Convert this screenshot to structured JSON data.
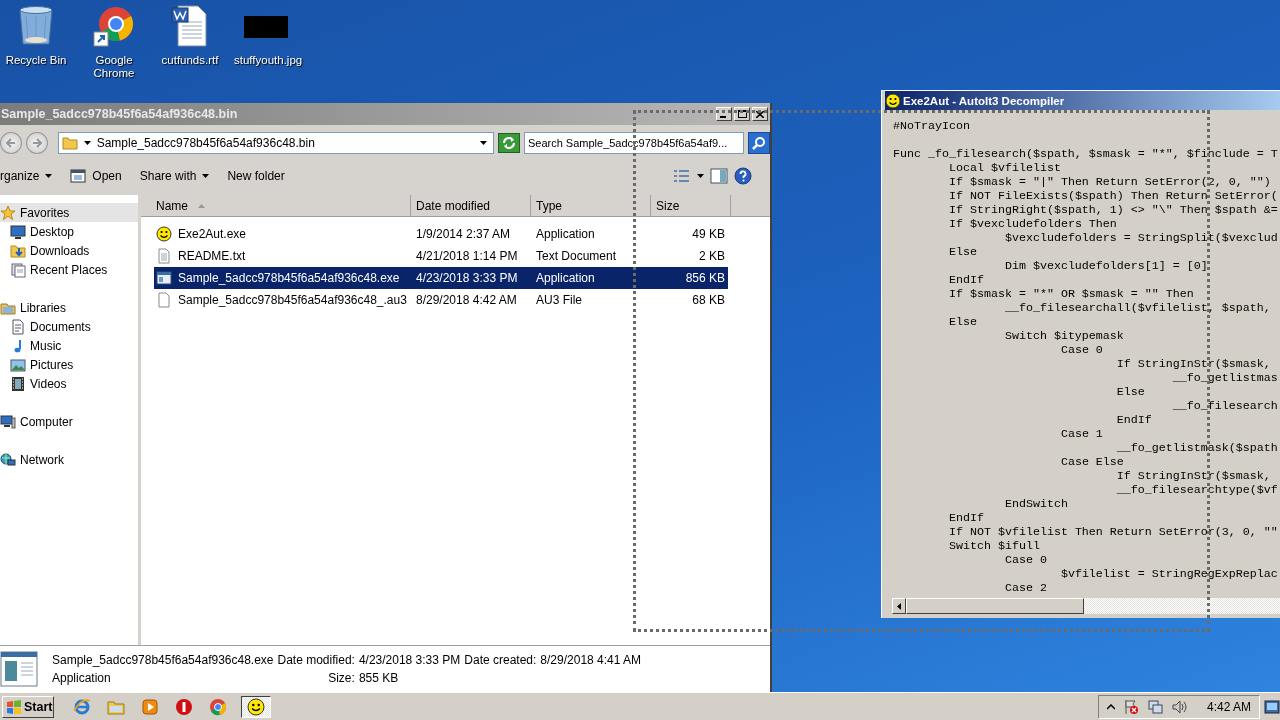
{
  "desktop_icons": [
    {
      "label": "Recycle Bin",
      "kind": "recycle"
    },
    {
      "label": "Google Chrome",
      "kind": "browser"
    },
    {
      "label": "cutfunds.rtf",
      "kind": "document"
    },
    {
      "label": "stuffyouth.jpg",
      "kind": "image"
    }
  ],
  "explorer": {
    "title": "Sample_5adcc978b45f6a54af936c48.bin",
    "address": "Sample_5adcc978b45f6a54af936c48.bin",
    "search": {
      "placeholder": "Search Sample_5adcc978b45f6a54af9..."
    },
    "toolbar": [
      {
        "label": "rganize",
        "kind": "menu"
      },
      {
        "label": "Open",
        "kind": "icon-button"
      },
      {
        "label": "Share with",
        "kind": "menu"
      },
      {
        "label": "New folder",
        "kind": "button"
      }
    ],
    "sidebar": [
      {
        "label": "Favorites",
        "kind": "star",
        "selected": true,
        "children": [
          {
            "label": "Desktop",
            "kind": "monitor",
            "selected": false
          },
          {
            "label": "Downloads",
            "kind": "downloads",
            "selected": false
          },
          {
            "label": "Recent Places",
            "kind": "recent",
            "selected": false
          }
        ]
      },
      {
        "label": "Libraries",
        "kind": "library",
        "selected": false,
        "children": [
          {
            "label": "Documents",
            "kind": "documents",
            "selected": false
          },
          {
            "label": "Music",
            "kind": "music",
            "selected": false
          },
          {
            "label": "Pictures",
            "kind": "pictures",
            "selected": false
          },
          {
            "label": "Videos",
            "kind": "videos",
            "selected": false
          }
        ]
      },
      {
        "label": "Computer",
        "kind": "computer",
        "selected": false
      },
      {
        "label": "Network",
        "kind": "network",
        "selected": false
      }
    ],
    "columns": [
      {
        "label": "Name",
        "sorted": true
      },
      {
        "label": "Date modified",
        "sorted": false
      },
      {
        "label": "Type",
        "sorted": false
      },
      {
        "label": "Size",
        "sorted": false
      }
    ],
    "files": [
      {
        "name": "Exe2Aut.exe",
        "date": "1/9/2014 2:37 AM",
        "type": "Application",
        "size": "49 KB",
        "kind": "smiley",
        "selected": false
      },
      {
        "name": "README.txt",
        "date": "4/21/2018 1:14 PM",
        "type": "Text Document",
        "size": "2 KB",
        "kind": "text",
        "selected": false
      },
      {
        "name": "Sample_5adcc978b45f6a54af936c48.exe",
        "date": "4/23/2018 3:33 PM",
        "type": "Application",
        "size": "856 KB",
        "kind": "app",
        "selected": true
      },
      {
        "name": "Sample_5adcc978b45f6a54af936c48_.au3",
        "date": "8/29/2018 4:42 AM",
        "type": "AU3 File",
        "size": "68 KB",
        "kind": "blank",
        "selected": false
      }
    ],
    "details": {
      "name": "Sample_5adcc978b45f6a54af936c48.exe",
      "type": "Application",
      "fields": [
        {
          "label": "Date modified:",
          "value": "4/23/2018 3:33 PM"
        },
        {
          "label": "Date created:",
          "value": "8/29/2018 4:41 AM"
        },
        {
          "label": "Size:",
          "value": "855 KB"
        }
      ]
    }
  },
  "decompiler": {
    "title": "Exe2Aut - AutoIt3 Decompiler",
    "blocks": [
      [
        "#NoTrayIcon"
      ],
      [
        "Func _fo_filesearch($spath, $smask = \"*\", $finclude = T",
        "\tLocal $vfilelist",
        "\tIf $smask = \"|\" Then Return SetError(2, 0, \"\")",
        "\tIf NOT FileExists($spath) Then Return SetError(",
        "\tIf StringRight($spath, 1) <> \"\\\" Then $spath &=",
        "\tIf $vexcludefolders Then",
        "\t\t$vexcludefolders = StringSplit($vexclud",
        "\tElse",
        "\t\tDim $vexcludefolders[1] = [0]",
        "\tEndIf",
        "\tIf $smask = \"*\" OR $smask = \"\" Then",
        "\t\t__fo_filesearchall($vfilelist, $spath,",
        "\tElse",
        "\t\tSwitch $itypemask",
        "\t\t\tCase 0",
        "\t\t\t\tIf StringInStr($smask,",
        "\t\t\t\t\t__fo_getlistmas",
        "\t\t\t\tElse",
        "\t\t\t\t\t__fo_filesearch",
        "\t\t\t\tEndIf",
        "\t\t\tCase 1",
        "\t\t\t\t__fo_getlistmask($spath",
        "\t\t\tCase Else",
        "\t\t\t\tIf StringInStr($smask,",
        "\t\t\t\t__fo_filesearchtype($vf",
        "\t\tEndSwitch",
        "\tEndIf",
        "\tIf NOT $vfilelist Then Return SetError(3, 0, \"\"",
        "\tSwitch $ifull",
        "\t\tCase 0",
        "\t\t\t$vfilelist = StringRegExpReplac",
        "\t\tCase 2"
      ]
    ]
  },
  "taskbar": {
    "start": "Start",
    "apps": [
      {
        "kind": "ie",
        "active": false
      },
      {
        "kind": "folder",
        "active": false
      },
      {
        "kind": "media",
        "active": false
      },
      {
        "kind": "stop",
        "active": false
      },
      {
        "kind": "chrome",
        "active": false
      },
      {
        "kind": "smiley",
        "active": true
      }
    ],
    "clock": "4:42 AM"
  }
}
